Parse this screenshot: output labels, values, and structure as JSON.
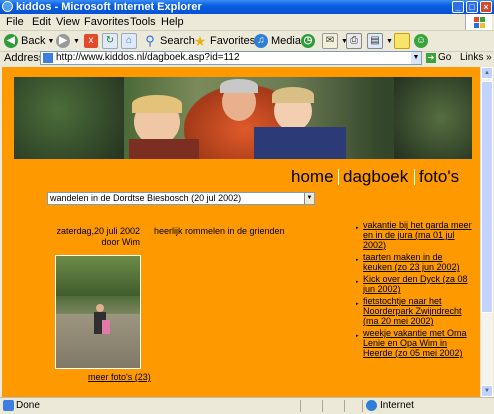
{
  "window": {
    "title": "kiddos - Microsoft Internet Explorer"
  },
  "menu": [
    "File",
    "Edit",
    "View",
    "Favorites",
    "Tools",
    "Help"
  ],
  "toolbar": {
    "back": "Back",
    "search": "Search",
    "favorites": "Favorites",
    "media": "Media"
  },
  "address": {
    "label": "Address",
    "url": "http://www.kiddos.nl/dagboek.asp?id=112",
    "go": "Go",
    "links": "Links"
  },
  "nav": {
    "home": "home",
    "dagboek": "dagboek",
    "fotos": "foto's"
  },
  "entry_select": {
    "value": "wandelen in de Dordtse Biesbosch (20 jul 2002)"
  },
  "entry": {
    "date": "zaterdag,20 juli 2002",
    "author": "door Wim",
    "text": "heerlijk rommelen in de grienden",
    "more_photos": "meer foto's (23)"
  },
  "related": [
    "vakantie bij het garda meer en in de jura (ma 01 jul 2002)",
    "taarten maken in de keuken (zo 23 jun 2002)",
    "Kick over den Dyck (za 08 jun 2002)",
    "fietstochtje naar het Noorderpark Zwijndrecht (ma 20 mei 2002)",
    "weekje vakantie met Oma Lenie en Opa Wim in Heerde (zo 05 mei 2002)"
  ],
  "status": {
    "text": "Done",
    "zone": "Internet"
  },
  "colors": {
    "page_bg": "#ff9900",
    "titlebar": "#0a5ee0"
  }
}
